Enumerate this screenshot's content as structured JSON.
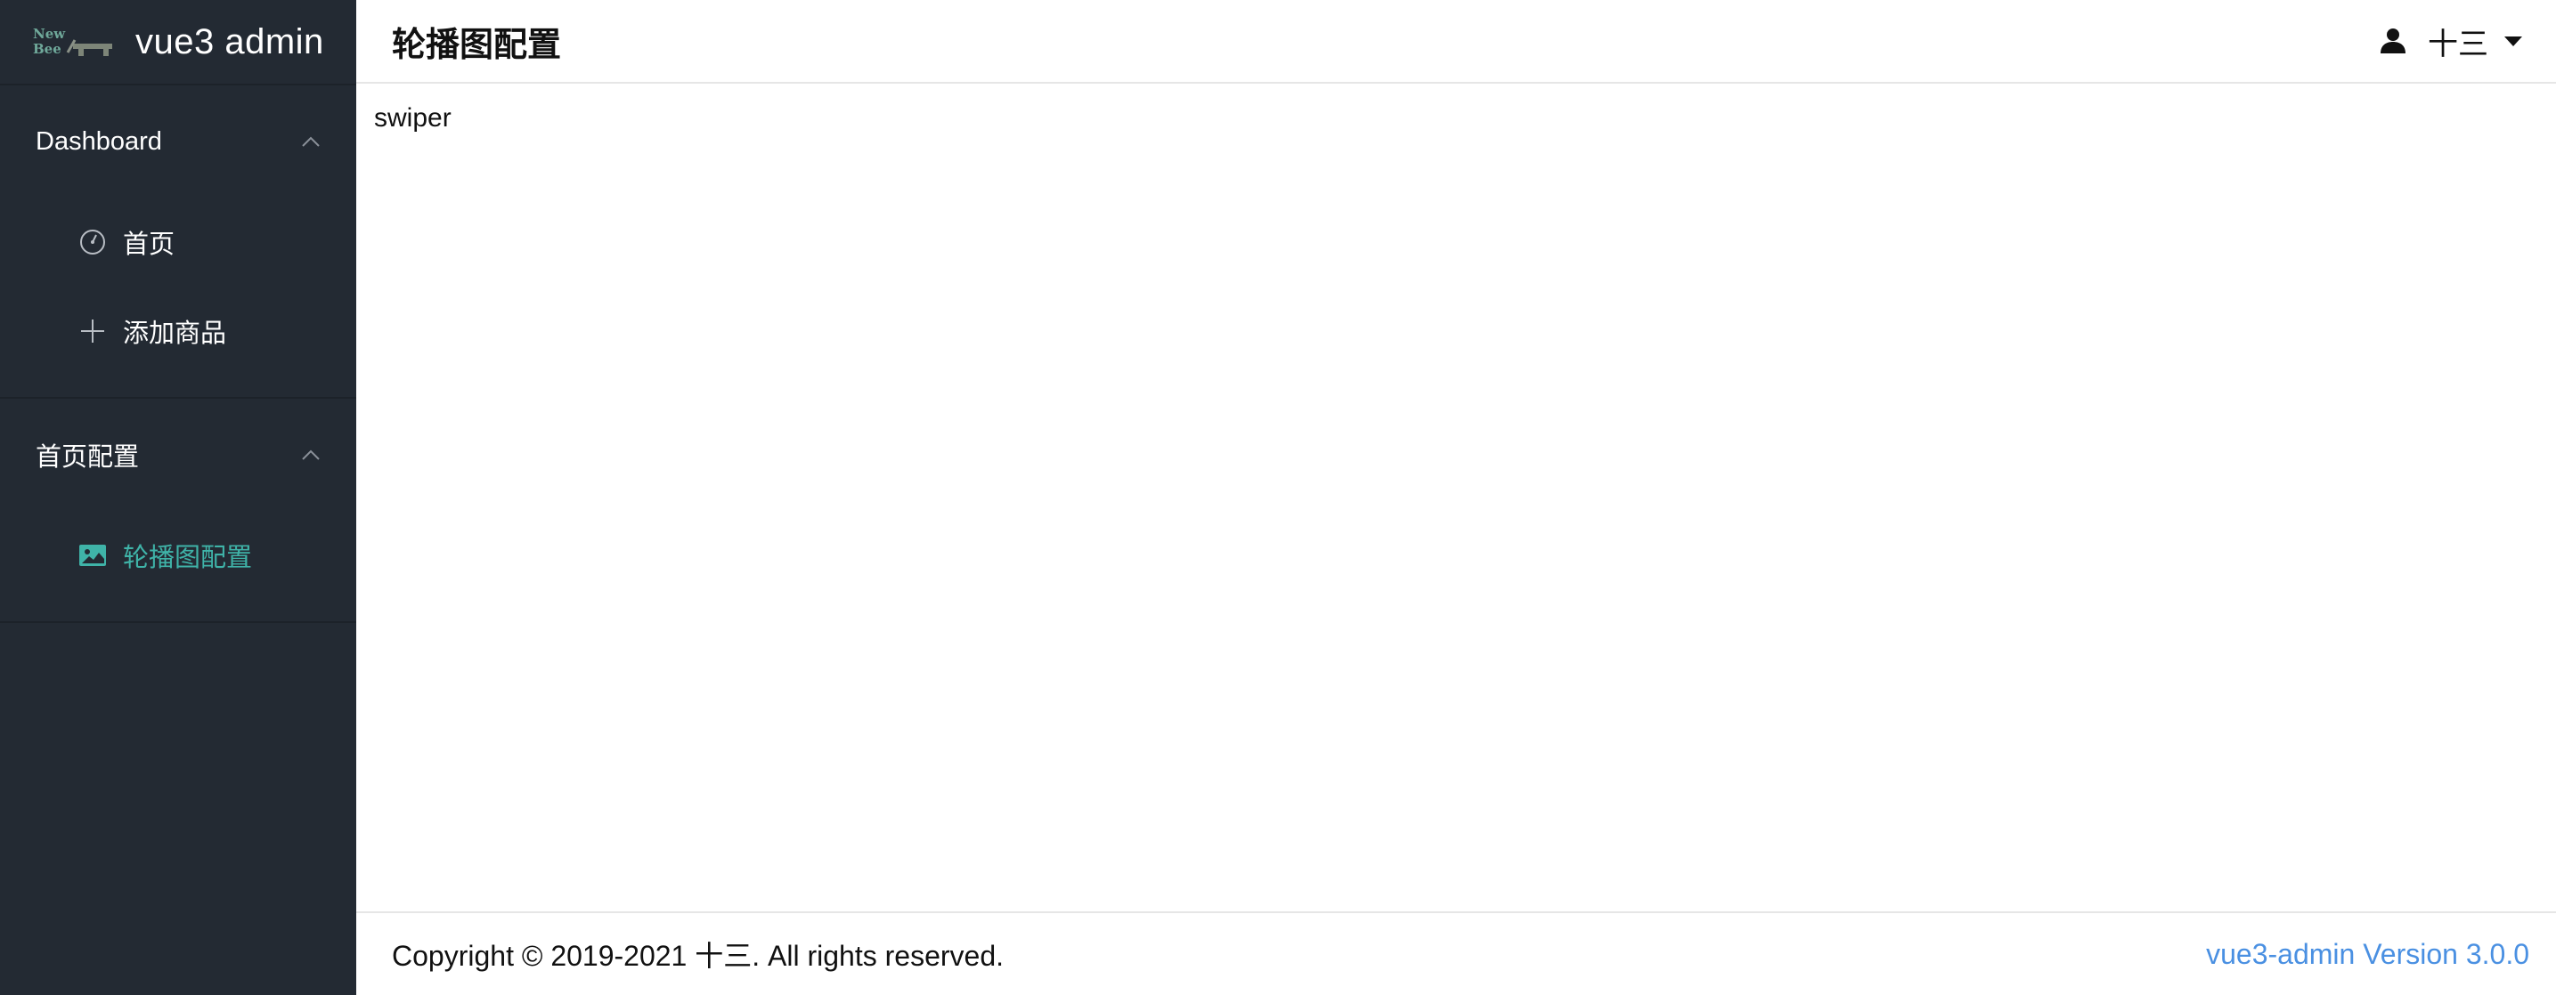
{
  "brand": {
    "logo_text_top": "New",
    "logo_text_bottom": "Bee",
    "name": "vue3 admin"
  },
  "sidebar": {
    "groups": [
      {
        "title": "Dashboard",
        "icon": "chevron-up-icon",
        "items": [
          {
            "label": "首页",
            "icon": "dashboard-gauge-icon",
            "active": false
          },
          {
            "label": "添加商品",
            "icon": "plus-icon",
            "active": false
          }
        ]
      },
      {
        "title": "首页配置",
        "icon": "chevron-up-icon",
        "items": [
          {
            "label": "轮播图配置",
            "icon": "picture-icon",
            "active": true
          }
        ]
      }
    ]
  },
  "header": {
    "title": "轮播图配置",
    "user": {
      "icon": "user-icon",
      "name": "十三",
      "dropdown_icon": "caret-down-icon"
    }
  },
  "main": {
    "content_text": "swiper"
  },
  "footer": {
    "copyright": "Copyright © 2019-2021 十三. All rights reserved.",
    "version": "vue3-admin Version 3.0.0"
  },
  "colors": {
    "sidebar_bg": "#232a33",
    "active_item": "#3fb3a8",
    "version_link": "#4a90e2"
  }
}
